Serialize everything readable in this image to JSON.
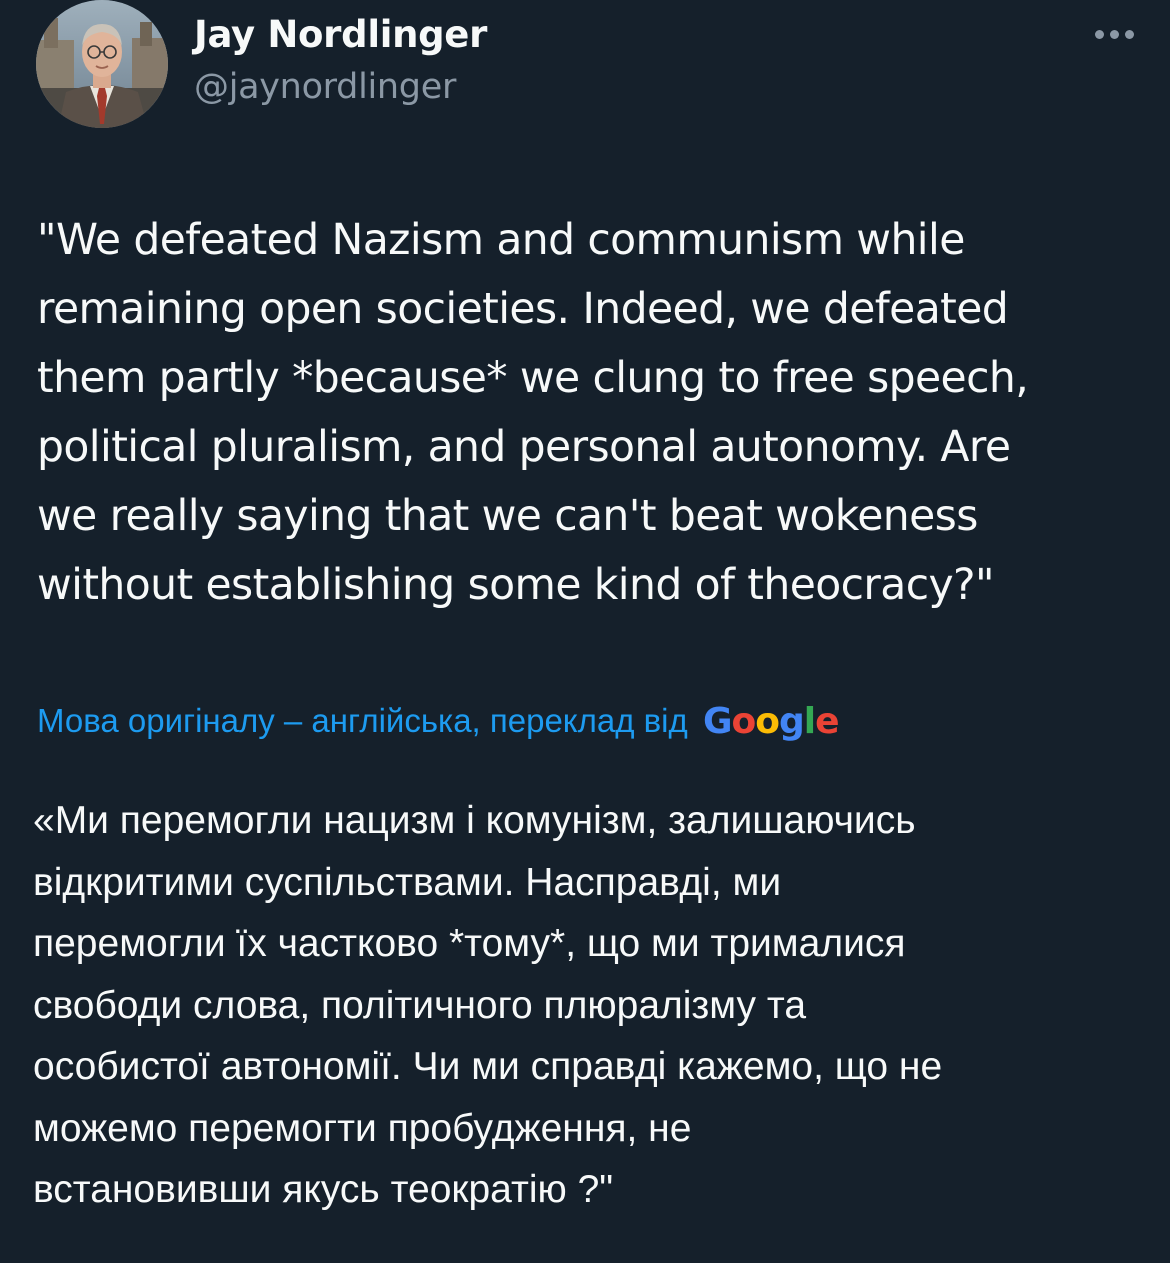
{
  "author": {
    "display_name": "Jay Nordlinger",
    "handle": "@jaynordlinger"
  },
  "tweet": {
    "text": "\"We defeated Nazism and communism while\nremaining open societies. Indeed, we defeated\nthem partly *because* we clung to free speech,\npolitical pluralism, and personal autonomy. Are\nwe really saying that we can't beat wokeness\nwithout establishing some kind of theocracy?\""
  },
  "translation": {
    "note": "Мова оригіналу – англійська, переклад від",
    "provider_letters": [
      "G",
      "o",
      "o",
      "g",
      "l",
      "e"
    ],
    "text": "«Ми перемогли нацизм і комунізм, залишаючись\nвідкритими суспільствами. Насправді, ми\nперемогли їх частково *тому*, що ми трималися\nсвободи слова, політичного плюралізму та\nособистої автономії. Чи ми справді кажемо, що не\nможемо перемогти пробудження, не\nвстановивши якусь теократію ?\""
  },
  "icons": {
    "more": "more-horizontal-icon"
  },
  "colors": {
    "background": "#15202b",
    "primary_text": "#f7f9f9",
    "secondary_text": "#8b98a5",
    "link": "#1d9bf0",
    "google_blue": "#4285f4",
    "google_red": "#ea4335",
    "google_yellow": "#fbbc05",
    "google_green": "#34a853"
  }
}
